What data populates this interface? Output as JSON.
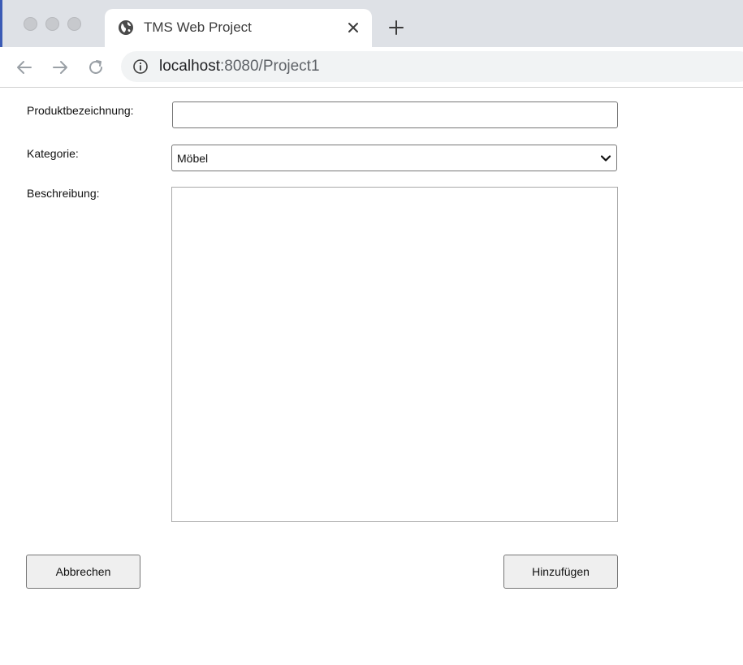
{
  "browser": {
    "tab_title": "TMS Web Project",
    "url_host": "localhost",
    "url_rest": ":8080/Project1"
  },
  "form": {
    "name_label": "Produktbezeichnung:",
    "name_value": "",
    "category_label": "Kategorie:",
    "category_selected": "Möbel",
    "description_label": "Beschreibung:",
    "description_value": ""
  },
  "actions": {
    "cancel_label": "Abbrechen",
    "add_label": "Hinzufügen"
  },
  "icons": {
    "tab_icon": "globe-icon",
    "tab_close": "close-icon",
    "new_tab": "plus-icon",
    "back": "arrow-left-icon",
    "forward": "arrow-right-icon",
    "reload": "reload-icon",
    "site_info": "info-icon",
    "select": "chevron-down-icon"
  }
}
